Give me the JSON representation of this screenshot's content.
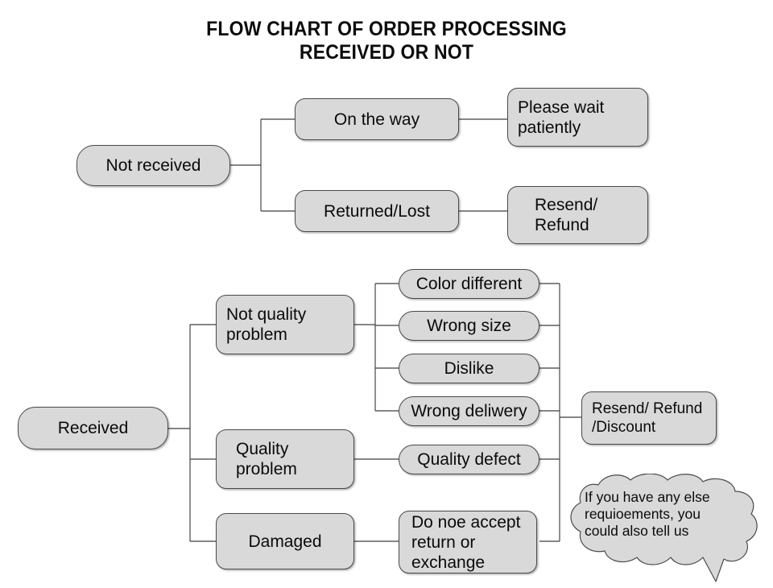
{
  "title": "FLOW CHART OF ORDER PROCESSING\nRECEIVED OR NOT",
  "colors": {
    "node_fill": "#d9d9d9",
    "node_border": "#4a4a4a",
    "connector": "#3f3f3f",
    "text": "#0a0a0a",
    "background": "#ffffff"
  },
  "flow_not_received": {
    "root": "Not received",
    "branches": [
      {
        "label": "On the way",
        "outcome": "Please wait\npatiently"
      },
      {
        "label": "Returned/Lost",
        "outcome": "Resend/\nRefund"
      }
    ]
  },
  "flow_received": {
    "root": "Received",
    "branches": [
      {
        "label": "Not quality\nproblem",
        "reasons": [
          "Color different",
          "Wrong size",
          "Dislike",
          "Wrong deliwery"
        ]
      },
      {
        "label": "Quality\nproblem",
        "reasons": [
          "Quality defect"
        ]
      },
      {
        "label": "Damaged",
        "reasons": [
          "Do noe accept\nreturn or\nexchange"
        ]
      }
    ],
    "outcome": "Resend/ Refund\n/Discount"
  },
  "callout": {
    "text": "If you have any else\nrequioements, you\ncould also tell us"
  }
}
